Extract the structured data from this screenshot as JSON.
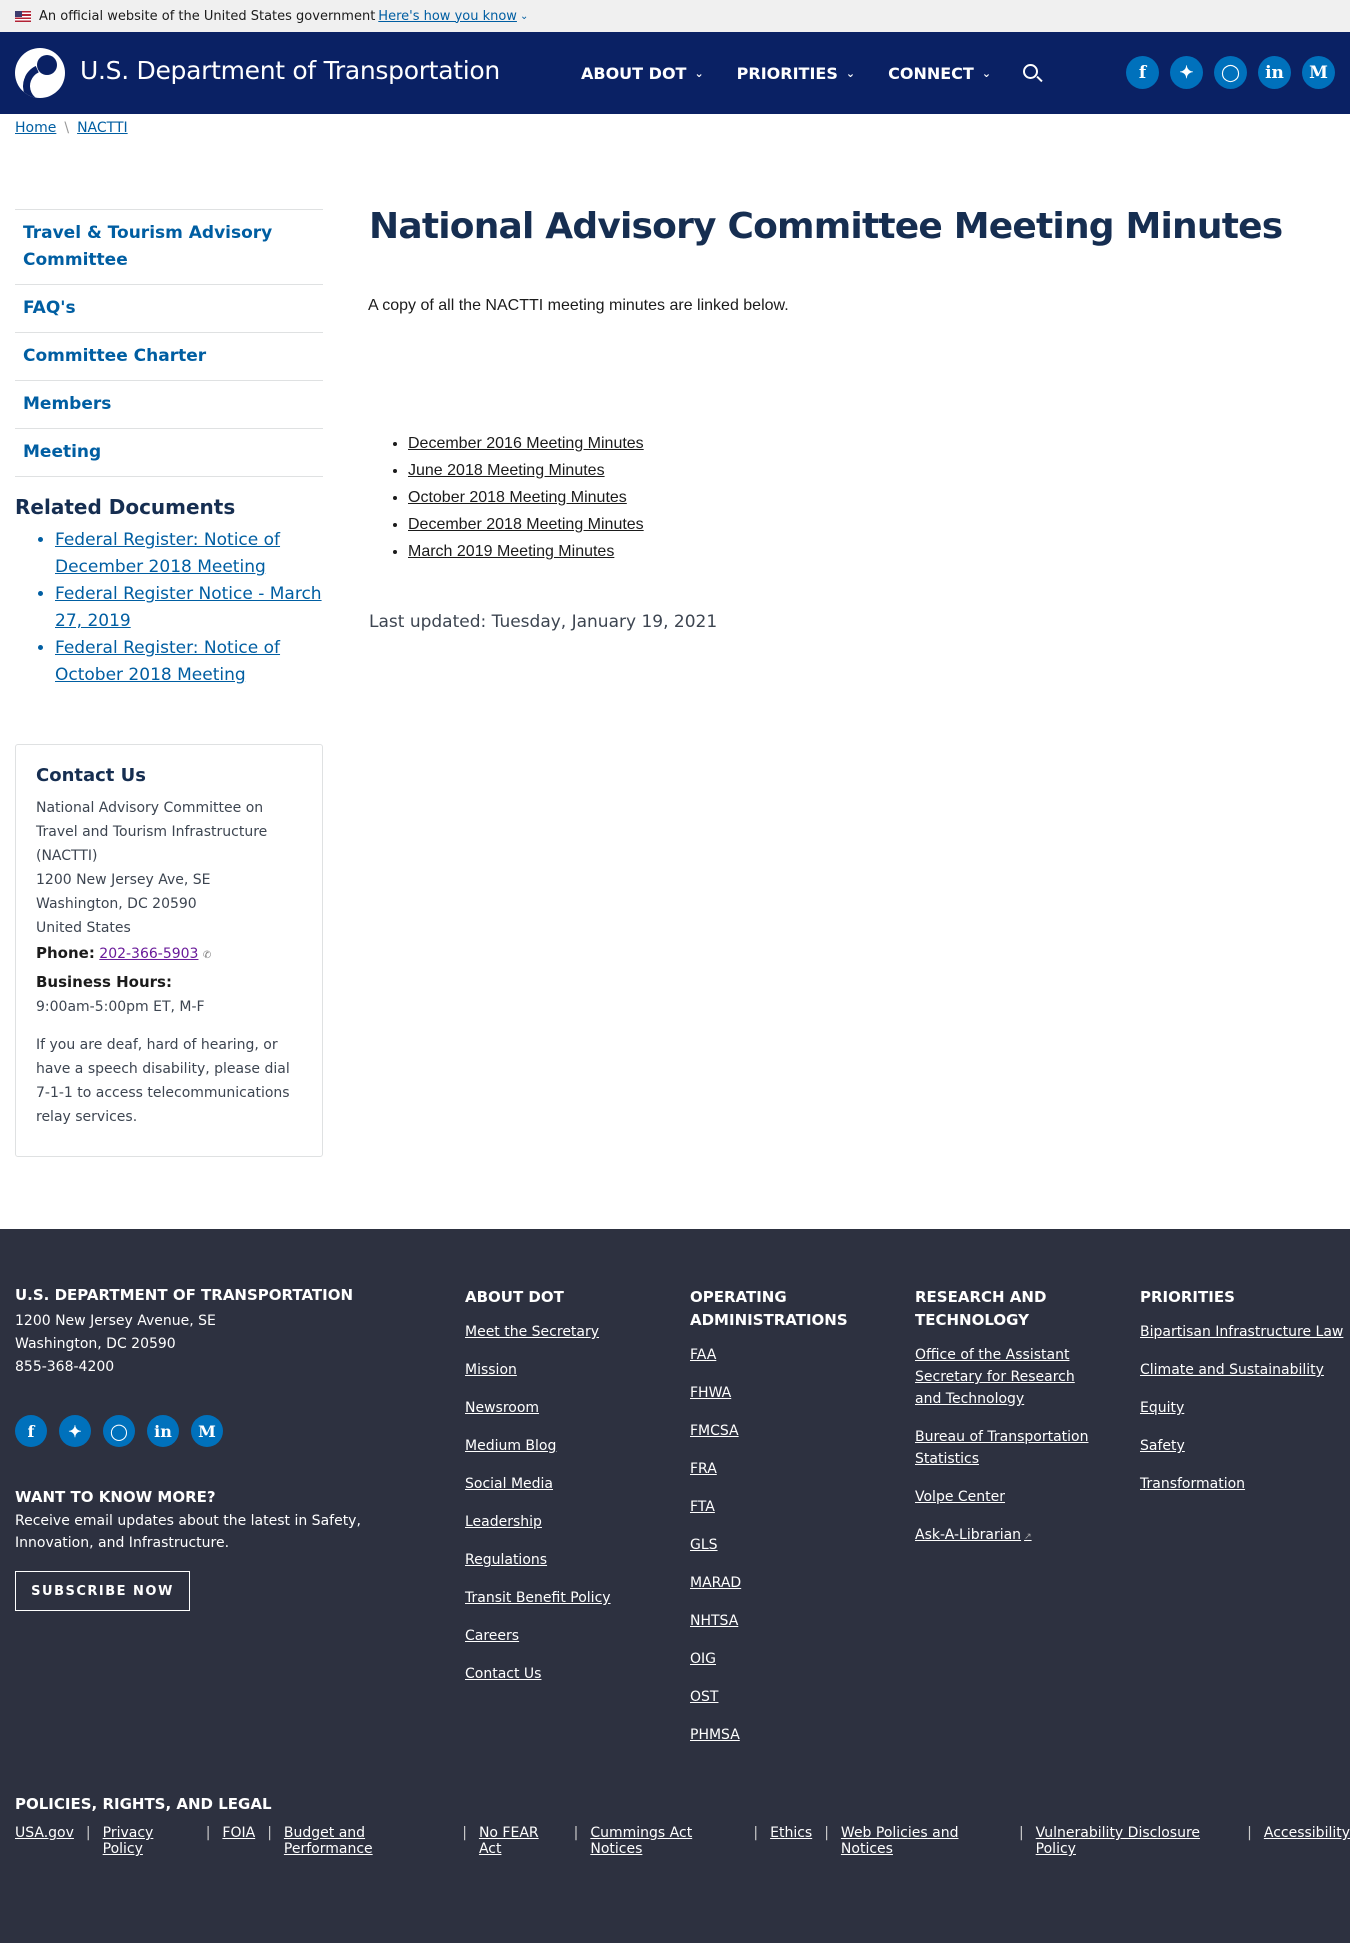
{
  "banner": {
    "text": "An official website of the United States government",
    "link": "Here's how you know"
  },
  "header": {
    "title": "U.S. Department of Transportation",
    "nav": [
      "ABOUT DOT",
      "PRIORITIES",
      "CONNECT"
    ],
    "social": [
      "f",
      "t",
      "ig",
      "in",
      "M"
    ]
  },
  "breadcrumb": {
    "home": "Home",
    "current": "NACTTI"
  },
  "sidebar": {
    "items": [
      "Travel & Tourism Advisory Committee",
      "FAQ's",
      "Committee Charter",
      "Members",
      "Meeting"
    ],
    "related_title": "Related Documents",
    "related": [
      "Federal Register: Notice of December 2018 Meeting",
      "Federal Register Notice - March 27, 2019",
      "Federal Register: Notice of October 2018 Meeting"
    ],
    "contact": {
      "title": "Contact Us",
      "org": "National Advisory Committee on Travel and Tourism Infrastructure (NACTTI)",
      "street": "1200 New Jersey Ave, SE",
      "city": "Washington, DC 20590",
      "country": "United States",
      "phone_label": "Phone:",
      "phone": "202-366-5903",
      "hours_label": "Business Hours:",
      "hours": "9:00am-5:00pm ET, M-F",
      "deaf_note": "If you are deaf, hard of hearing, or have a speech disability, please dial 7-1-1 to access telecommunications relay services."
    }
  },
  "main": {
    "title": "National Advisory Committee Meeting Minutes",
    "intro": "A copy of all the NACTTI meeting minutes are linked below.",
    "minutes": [
      "December 2016 Meeting Minutes",
      "June 2018 Meeting Minutes",
      "October 2018 Meeting Minutes",
      "December 2018 Meeting Minutes",
      "March 2019 Meeting Minutes"
    ],
    "updated": "Last updated: Tuesday, January 19, 2021"
  },
  "footer": {
    "org_title": "U.S. DEPARTMENT OF TRANSPORTATION",
    "address1": "1200 New Jersey Avenue, SE",
    "address2": "Washington, DC 20590",
    "phone": "855-368-4200",
    "more_title": "WANT TO KNOW MORE?",
    "more_text": "Receive email updates about the latest in Safety, Innovation, and Infrastructure.",
    "subscribe": "SUBSCRIBE NOW",
    "about": {
      "title": "ABOUT DOT",
      "links": [
        "Meet the Secretary",
        "Mission",
        "Newsroom",
        "Medium Blog",
        "Social Media",
        "Leadership",
        "Regulations",
        "Transit Benefit Policy",
        "Careers",
        "Contact Us"
      ]
    },
    "operating": {
      "title": "OPERATING ADMINISTRATIONS",
      "links": [
        "FAA",
        "FHWA",
        "FMCSA",
        "FRA",
        "FTA",
        "GLS",
        "MARAD",
        "NHTSA",
        "OIG",
        "OST",
        "PHMSA"
      ]
    },
    "research": {
      "title": "RESEARCH AND TECHNOLOGY",
      "links": [
        "Office of the Assistant Secretary for Research and Technology",
        "Bureau of Transportation Statistics",
        "Volpe Center",
        "Ask-A-Librarian"
      ]
    },
    "priorities": {
      "title": "PRIORITIES",
      "links": [
        "Bipartisan Infrastructure Law",
        "Climate and Sustainability",
        "Equity",
        "Safety",
        "Transformation"
      ]
    },
    "policy_title": "POLICIES, RIGHTS, AND LEGAL",
    "policy_links": [
      "USA.gov",
      "Privacy Policy",
      "FOIA",
      "Budget and Performance",
      "No FEAR Act",
      "Cummings Act Notices",
      "Ethics",
      "Web Policies and Notices",
      "Vulnerability Disclosure Policy",
      "Accessibility"
    ]
  }
}
